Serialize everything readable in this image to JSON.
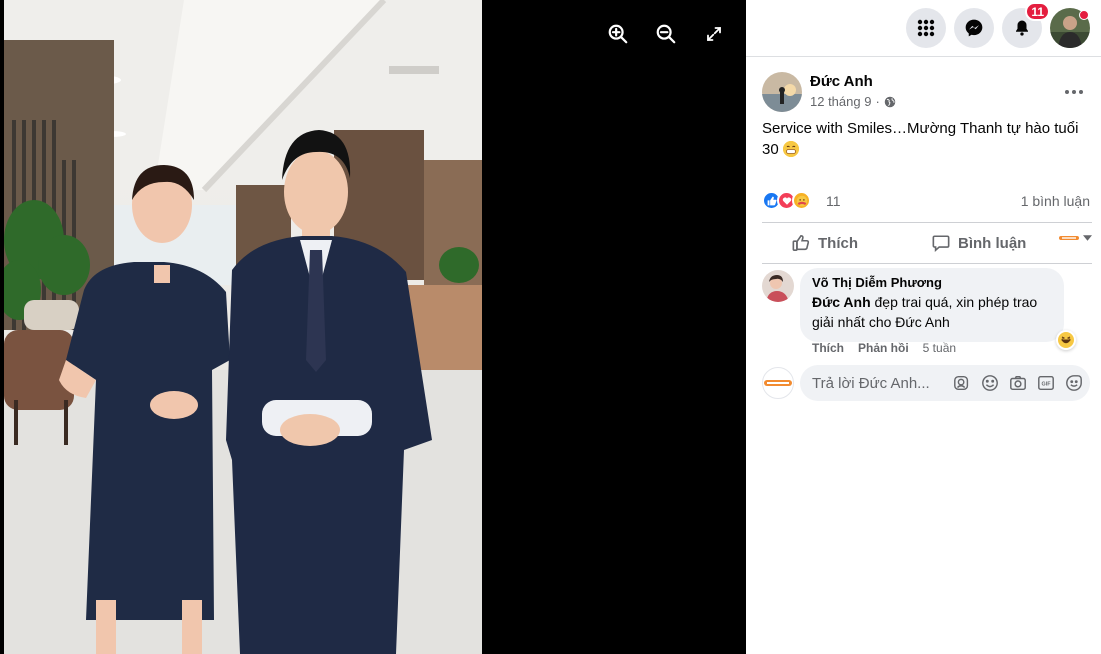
{
  "viewer": {
    "tools": [
      {
        "name": "zoom-in-icon"
      },
      {
        "name": "zoom-out-icon"
      },
      {
        "name": "fullscreen-icon"
      }
    ]
  },
  "topbar": {
    "notification_count": "11",
    "icons": [
      "menu-grid-icon",
      "messenger-icon",
      "bell-icon"
    ]
  },
  "post": {
    "author": "Đức Anh",
    "date": "12 tháng 9",
    "separator": "·",
    "text": "Service with Smiles…Mường Thanh tự hào tuổi 30",
    "reaction_count": "11",
    "comment_count": "1 bình luận",
    "like_label": "Thích",
    "comment_label": "Bình luận"
  },
  "comment": {
    "author": "Võ Thị Diễm Phương",
    "mention": "Đức Anh",
    "text": " đẹp trai quá, xin phép trao giải nhất cho Đức Anh",
    "like": "Thích",
    "reply": "Phản hồi",
    "time": "5 tuần"
  },
  "reply_box": {
    "placeholder": "Trả lời Đức Anh..."
  },
  "colors": {
    "like_blue": "#1877f2",
    "love_red": "#f33e58",
    "care_yellow": "#f7b125",
    "badge_red": "#e41e3f"
  }
}
